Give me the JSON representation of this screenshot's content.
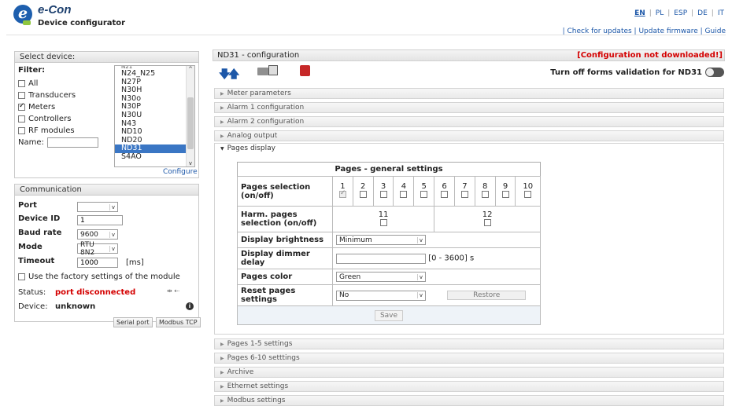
{
  "header": {
    "brand": "e-Con",
    "subtitle": "Device configurator",
    "languages": [
      "EN",
      "PL",
      "ESP",
      "DE",
      "IT"
    ],
    "active_language": "EN",
    "links": "| Check for updates | Update firmware | Guide"
  },
  "select_device": {
    "title": "Select device:",
    "filter_label": "Filter:",
    "filters": [
      {
        "label": "All",
        "checked": false
      },
      {
        "label": "Transducers",
        "checked": false
      },
      {
        "label": "Meters",
        "checked": true
      },
      {
        "label": "Controllers",
        "checked": false
      },
      {
        "label": "RF modules",
        "checked": false
      }
    ],
    "name_label": "Name:",
    "name_value": "",
    "devices": [
      "N24_N25",
      "N27P",
      "N30H",
      "N30o",
      "N30P",
      "N30U",
      "N43",
      "ND10",
      "ND20",
      "ND31",
      "S4AO"
    ],
    "selected_device": "ND31",
    "configure_label": "Configure"
  },
  "communication": {
    "title": "Communication",
    "port_label": "Port",
    "port_value": "",
    "device_id_label": "Device ID",
    "device_id_value": "1",
    "baud_label": "Baud rate",
    "baud_value": "9600",
    "mode_label": "Mode",
    "mode_value": "RTU 8N2",
    "timeout_label": "Timeout",
    "timeout_value": "1000",
    "timeout_unit": "[ms]",
    "factory_label": "Use the factory settings of the module",
    "status_label": "Status:",
    "status_value": "port disconnected",
    "device_label": "Device:",
    "device_value": "unknown",
    "tabs": [
      "Serial port",
      "Modbus TCP"
    ]
  },
  "config": {
    "title": "ND31 - configuration",
    "warning": "[Configuration not downloaded!]",
    "validation_label": "Turn off forms validation for ND31",
    "sections_top": [
      "Meter parameters",
      "Alarm 1 configuration",
      "Alarm 2 configuration",
      "Analog output"
    ],
    "open_section": "Pages display",
    "sections_bottom": [
      "Pages 1-5 settings",
      "Pages 6-10 setttings",
      "Archive",
      "Ethernet settings",
      "Modbus settings"
    ]
  },
  "pages": {
    "header": "Pages - general settings",
    "selection_label": "Pages selection (on/off)",
    "page_numbers": [
      "1",
      "2",
      "3",
      "4",
      "5",
      "6",
      "7",
      "8",
      "9",
      "10"
    ],
    "page_checked": [
      true,
      false,
      false,
      false,
      false,
      false,
      false,
      false,
      false,
      false
    ],
    "harm_label": "Harm. pages selection (on/off)",
    "harm_numbers": [
      "11",
      "12"
    ],
    "brightness_label": "Display brightness",
    "brightness_value": "Minimum",
    "dimmer_label": "Display dimmer delay",
    "dimmer_value": "",
    "dimmer_range": "[0 - 3600] s",
    "color_label": "Pages color",
    "color_value": "Green",
    "reset_label": "Reset pages settings",
    "reset_value": "No",
    "restore_label": "Restore",
    "save_label": "Save"
  },
  "colors": {
    "warning": "#d40000",
    "status": "#d40000",
    "accent": "#1c57a8"
  },
  "icons": [
    "download-arrow-icon",
    "upload-arrow-icon",
    "open-folder-icon",
    "save-file-icon",
    "pdf-icon",
    "info-icon",
    "toggle-switch"
  ]
}
